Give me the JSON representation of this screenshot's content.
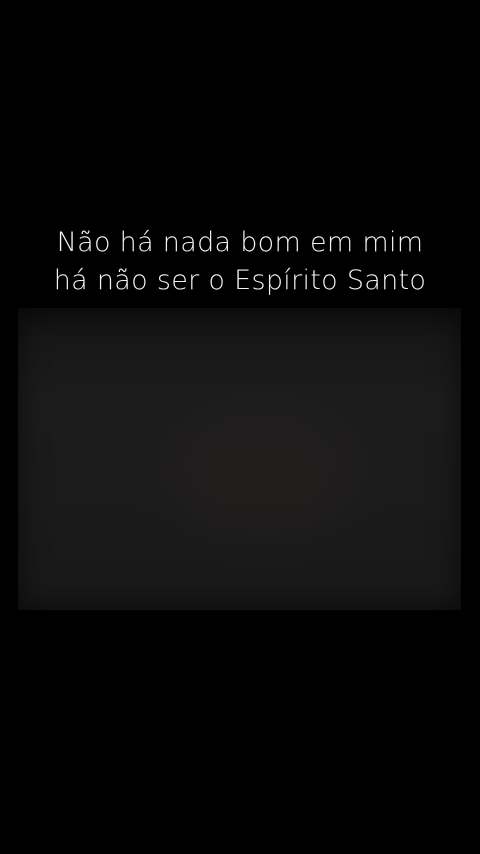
{
  "caption": {
    "line1": "Não há nada bom em mim",
    "line2": "há não ser o Espírito Santo"
  }
}
